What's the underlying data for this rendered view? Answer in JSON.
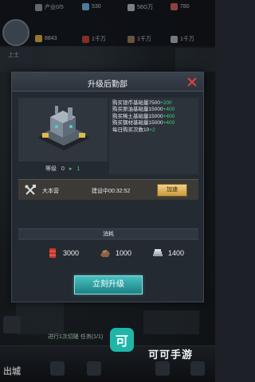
{
  "hud": {
    "player_level": "上士",
    "resources": [
      {
        "label": "产业0/5",
        "icon": "industry-icon",
        "color": "#9aa6b3"
      },
      {
        "label": "530",
        "icon": "gem-icon",
        "color": "#7fc6ff"
      },
      {
        "label": "56G万",
        "icon": "shield-res-icon",
        "color": "#c9d1d9"
      },
      {
        "label": "780",
        "icon": "gift-icon",
        "color": "#e36a6a"
      },
      {
        "label": "8843",
        "icon": "coin-icon",
        "color": "#f0c24a"
      },
      {
        "label": "1千万",
        "icon": "oil-icon",
        "color": "#d34a3c"
      },
      {
        "label": "1千万",
        "icon": "ore-icon",
        "color": "#a9876a"
      },
      {
        "label": "1千万",
        "icon": "steel-icon",
        "color": "#bfc6ce"
      }
    ]
  },
  "dialog": {
    "title": "升级后勤部",
    "level_label": "等级",
    "level_current": "0",
    "level_next": "1",
    "info_lines": [
      {
        "text": "购买银币基础量7500",
        "plus": "+200"
      },
      {
        "text": "购买原油基础量15000",
        "plus": "+400"
      },
      {
        "text": "购买稀土基础量15000",
        "plus": "+400"
      },
      {
        "text": "购买钢材基础量15000",
        "plus": "+400"
      },
      {
        "text": "每日购买次数10",
        "plus": "+2"
      }
    ],
    "build": {
      "name": "大本营",
      "status": "建设中00:32:52",
      "speed_label": "加速"
    },
    "cost_title": "消耗",
    "costs": [
      {
        "value": "3000",
        "icon": "oil-barrel-icon"
      },
      {
        "value": "1000",
        "icon": "ore-icon"
      },
      {
        "value": "1400",
        "icon": "steel-icon"
      }
    ],
    "upgrade_label": "立刻升级"
  },
  "bottom": {
    "exit_label": "出城",
    "task_text": "进行1次切磋  任务(1/1)",
    "watermark": "可",
    "watermark_text": "可可手游"
  }
}
